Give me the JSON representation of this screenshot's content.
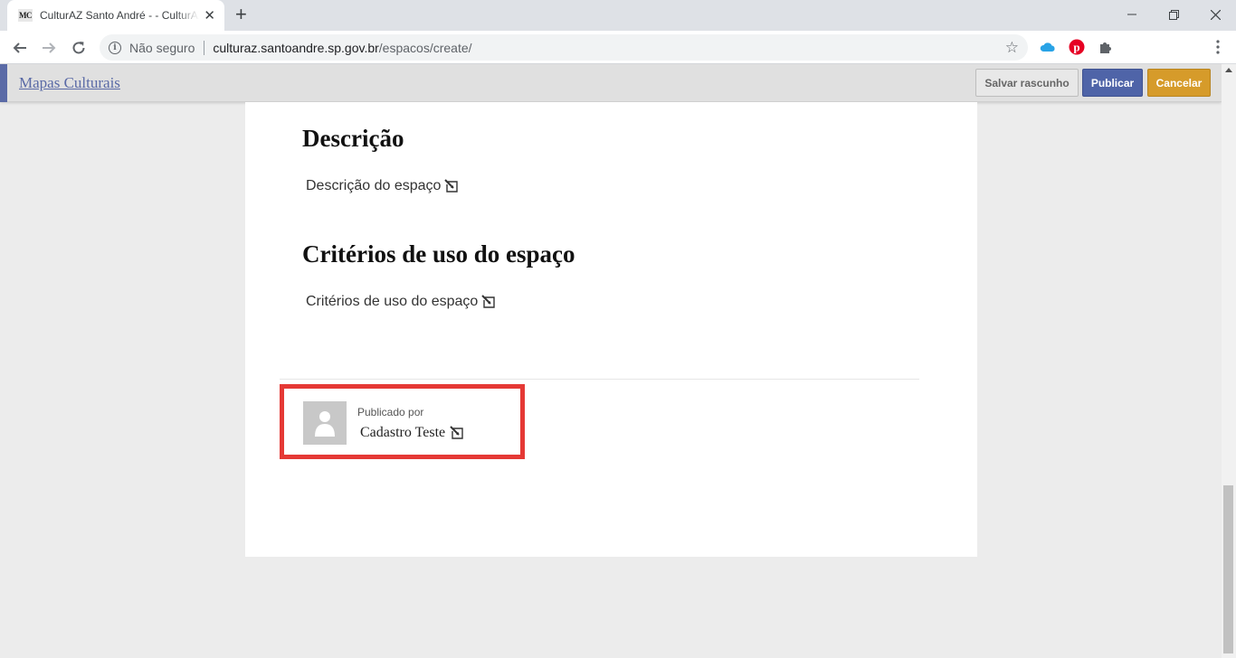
{
  "browser": {
    "tab": {
      "favicon_text": "MC",
      "title": "CulturAZ Santo André - - CulturAZ Santo André"
    },
    "omnibox": {
      "security_label": "Não seguro",
      "url_host": "culturaz.santoandre.sp.gov.br",
      "url_path": "/espacos/create/"
    }
  },
  "header": {
    "brand": "Mapas Culturais",
    "buttons": {
      "save_draft": "Salvar rascunho",
      "publish": "Publicar",
      "cancel": "Cancelar"
    },
    "accent_color": "#5a6aa6"
  },
  "content": {
    "description": {
      "title": "Descrição",
      "placeholder": "Descrição do espaço"
    },
    "criteria": {
      "title": "Critérios de uso do espaço",
      "placeholder": "Critérios de uso do espaço"
    },
    "publisher": {
      "label": "Publicado por",
      "name": "Cadastro Teste"
    }
  },
  "colors": {
    "highlight": "#e53935",
    "publish_button": "#4f64a8",
    "cancel_button": "#d69b2a"
  }
}
